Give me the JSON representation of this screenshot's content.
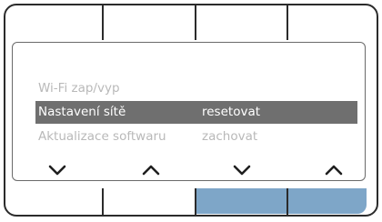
{
  "menu": {
    "items": [
      {
        "label": "Wi-Fi zap/vyp",
        "value": "",
        "state": "dim"
      },
      {
        "label": "Nastavení sítě",
        "value": "resetovat",
        "state": "selected"
      },
      {
        "label": "Aktualizace softwaru",
        "value": "zachovat",
        "state": "dim"
      }
    ]
  },
  "nav_buttons": [
    {
      "icon": "chevron-down-icon"
    },
    {
      "icon": "chevron-up-icon"
    },
    {
      "icon": "chevron-down-icon"
    },
    {
      "icon": "chevron-up-icon"
    }
  ],
  "colors": {
    "frame": "#2b2b2b",
    "selection": "#6f6f6f",
    "dim_text": "#b9b9b9",
    "active_softkey": "#7ea6c8"
  }
}
